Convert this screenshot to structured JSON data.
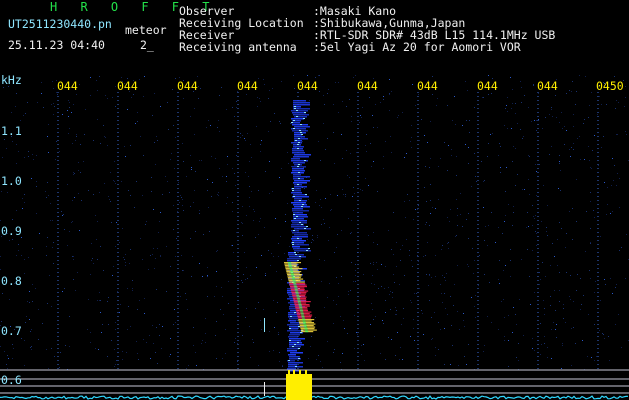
{
  "header": {
    "title": "H R O F F T",
    "filename": "UT2511230440.pn",
    "kind": "meteor",
    "timestamp": "25.11.23 04:40",
    "seconds": "2_",
    "labels": [
      "Observer",
      "Receiving Location",
      "Receiver",
      "Receiving antenna"
    ],
    "values": [
      ":Masaki Kano",
      ":Shibukawa,Gunma,Japan",
      ":RTL-SDR SDR# 43dB L15 114.1MHz USB",
      ":5el Yagi Az 20 for Aomori VOR"
    ]
  },
  "axis": {
    "unit": "kHz",
    "y_ticks": [
      "1.1",
      "1.0",
      "0.9",
      "0.8",
      "0.7",
      "0.6"
    ],
    "x_ticks": [
      "044",
      "044",
      "044",
      "044",
      "044",
      "044",
      "044",
      "044",
      "044",
      "0450"
    ]
  },
  "colors": {
    "background": "#000000",
    "grid": "#8fe6ff",
    "timeline": "#ffee00",
    "signal_hot": "#ff2050",
    "signal_cold": "#2040ff"
  }
}
